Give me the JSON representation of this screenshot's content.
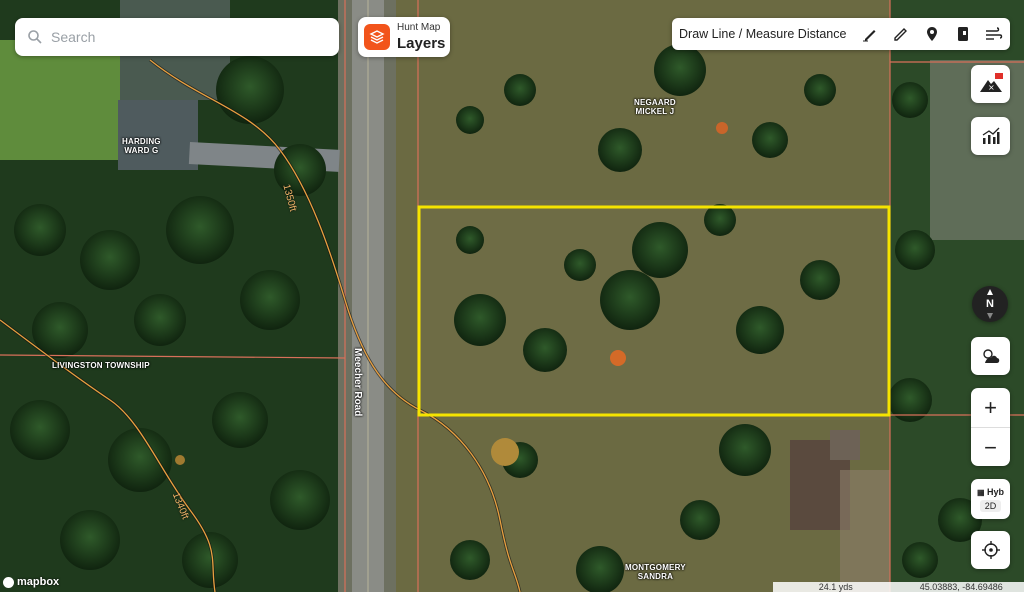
{
  "search": {
    "placeholder": "Search"
  },
  "layers": {
    "subtitle": "Hunt Map",
    "title": "Layers"
  },
  "toolbar": {
    "label": "Draw Line / Measure Distance"
  },
  "map_labels": {
    "harding": "HARDING\nWARD G",
    "negaard": "NEGAARD\nMICKEL J",
    "township": "LIVINGSTON TOWNSHIP",
    "montgomery": "MONTGOMERY\nSANDRA",
    "road": "Meecher Road",
    "contour1": "1350ft",
    "contour2": "1340ft"
  },
  "compass": {
    "label": "N"
  },
  "zoom": {
    "in": "+",
    "out": "−"
  },
  "basemap": {
    "mode": "Hyb",
    "view": "2D"
  },
  "attribution": "mapbox",
  "scale": {
    "distance": "24.1 yds",
    "coords": "45.03883, -84.69486"
  },
  "colors": {
    "highlight": "#f5e400",
    "parcel_line": "#d8705a",
    "contour": "#e8a040",
    "brand": "#f2541b"
  }
}
